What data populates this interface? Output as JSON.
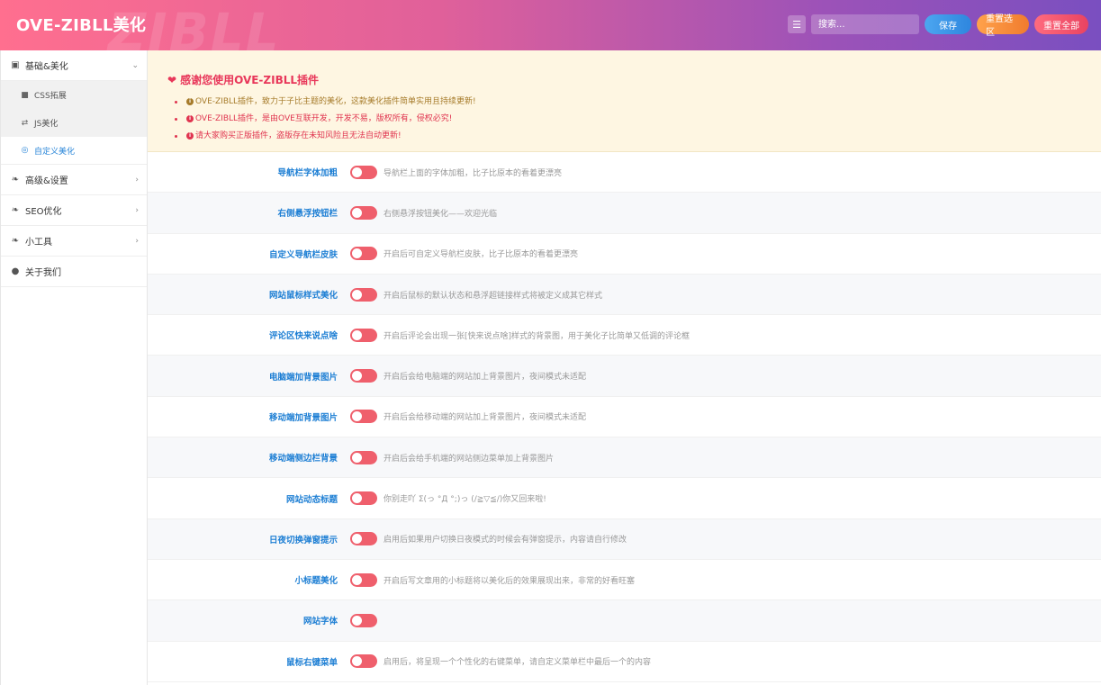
{
  "header": {
    "title": "OVE-ZIBLL美化",
    "watermark": "ZIBLL",
    "search_placeholder": "搜索...",
    "save_label": "保存",
    "reset_section_label": "重置选区",
    "reset_all_label": "重置全部"
  },
  "sidebar": {
    "items": [
      {
        "label": "基础&美化",
        "icon": "calendar-icon",
        "expanded": true,
        "children": [
          {
            "label": "CSS拓展",
            "icon": "file-icon"
          },
          {
            "label": "JS美化",
            "icon": "exchange-icon"
          },
          {
            "label": "自定义美化",
            "icon": "palette-icon",
            "active": true
          }
        ]
      },
      {
        "label": "高级&设置",
        "icon": "leaf-icon"
      },
      {
        "label": "SEO优化",
        "icon": "leaf-icon"
      },
      {
        "label": "小工具",
        "icon": "leaf-icon"
      },
      {
        "label": "关于我们",
        "icon": "user-circle-icon"
      }
    ]
  },
  "notice": {
    "title": "感谢您使用OVE-ZIBLL插件",
    "lines": [
      "OVE-ZIBLL插件，致力于子比主题的美化，这款美化插件简单实用且持续更新!",
      "OVE-ZIBLL插件，是由OVE互联开发，开发不易，版权所有，侵权必究!",
      "请大家购买正版插件，盗版存在未知风险且无法自动更新!"
    ]
  },
  "settings": [
    {
      "label": "导航栏字体加粗",
      "desc": "导航栏上面的字体加粗，比子比原本的看着更漂亮"
    },
    {
      "label": "右侧悬浮按钮栏",
      "desc": "右侧悬浮按钮美化——欢迎光临"
    },
    {
      "label": "自定义导航栏皮肤",
      "desc": "开启后可自定义导航栏皮肤，比子比原本的看着更漂亮"
    },
    {
      "label": "网站鼠标样式美化",
      "desc": "开启后鼠标的默认状态和悬浮超链接样式将被定义成其它样式"
    },
    {
      "label": "评论区快来说点啥",
      "desc": "开启后评论会出现一张[快来说点啥]样式的背景图，用于美化子比简单又低调的评论框"
    },
    {
      "label": "电脑端加背景图片",
      "desc": "开启后会给电脑端的网站加上背景图片，夜间模式未适配"
    },
    {
      "label": "移动端加背景图片",
      "desc": "开启后会给移动端的网站加上背景图片，夜间模式未适配"
    },
    {
      "label": "移动端侧边栏背景",
      "desc": "开启后会给手机端的网站侧边菜单加上背景图片"
    },
    {
      "label": "网站动态标题",
      "desc": "你别走吖 Σ(っ °Д °;)っ (/≧▽≦/)你又回来啦!"
    },
    {
      "label": "日夜切换弹窗提示",
      "desc": "启用后如果用户切换日夜模式的时候会有弹窗提示，内容请自行修改"
    },
    {
      "label": "小标题美化",
      "desc": "开启后写文章用的小标题将以美化后的效果展现出来，非常的好看旺塞"
    },
    {
      "label": "网站字体",
      "desc": ""
    },
    {
      "label": "鼠标右键菜单",
      "desc": "启用后，将呈现一个个性化的右键菜单，请自定义菜单栏中最后一个的内容"
    }
  ],
  "colors": {
    "accent_blue": "#1e7fd4",
    "toggle_red": "#ef5f6c",
    "notice_red": "#e0344f"
  }
}
